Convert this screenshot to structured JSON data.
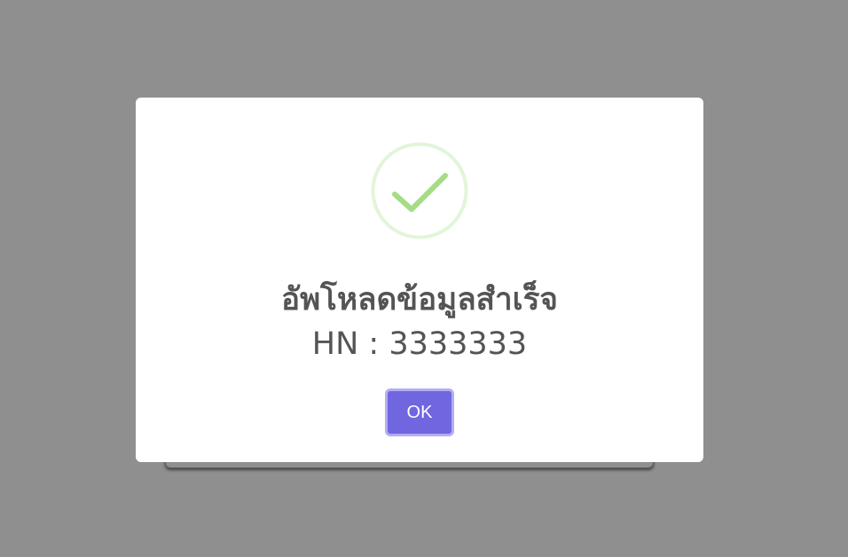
{
  "dialog": {
    "title": "อัพโหลดข้อมูลสำเร็จ",
    "message": "HN : 3333333",
    "icon": "success-check-icon",
    "ok_label": "OK"
  },
  "colors": {
    "overlay": "#8f8f8f",
    "dialog_background": "#ffffff",
    "text": "#545454",
    "success_green": "#a5dc86",
    "success_ring": "#e2f5d8",
    "button": "#7066e0",
    "button_focus_ring": "#b4aef3"
  }
}
